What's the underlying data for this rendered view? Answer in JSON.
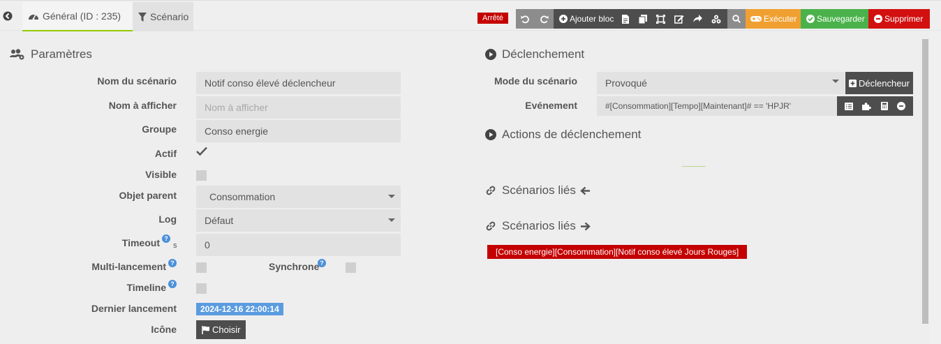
{
  "tabs": {
    "general": "Général (ID : 235)",
    "scenario": "Scénario"
  },
  "toolbar": {
    "status": "Arrêté",
    "add_block": "Ajouter bloc",
    "execute": "Exécuter",
    "save": "Sauvegarder",
    "delete": "Supprimer"
  },
  "params": {
    "title": "Paramètres",
    "name_label": "Nom du scénario",
    "name_value": "Notif conso élevé déclencheur",
    "display_label": "Nom à afficher",
    "display_placeholder": "Nom à afficher",
    "group_label": "Groupe",
    "group_value": "Conso energie",
    "active_label": "Actif",
    "visible_label": "Visible",
    "parent_label": "Objet parent",
    "parent_value": "Consommation",
    "log_label": "Log",
    "log_value": "Défaut",
    "timeout_label": "Timeout",
    "timeout_unit": "s",
    "timeout_value": "0",
    "multi_label": "Multi-lancement",
    "sync_label": "Synchrone",
    "timeline_label": "Timeline",
    "last_run_label": "Dernier lancement",
    "last_run_value": "2024-12-16 22:00:14",
    "icon_label": "Icône",
    "choose_label": "Choisir"
  },
  "trigger": {
    "title": "Déclenchement",
    "mode_label": "Mode du scénario",
    "mode_value": "Provoqué",
    "trigger_button": "Déclencheur",
    "event_label": "Evénement",
    "event_value": "#[Consommation][Tempo][Maintenant]# == 'HPJR'",
    "actions_title": "Actions de déclenchement",
    "linked_in_title": "Scénarios liés",
    "linked_out_title": "Scénarios liés",
    "linked_scenario": "[Conso energie][Consommation][Notif conso élevé Jours Rouges]"
  },
  "colors": {
    "status_red": "#c40000",
    "execute_orange": "#f0a030",
    "save_green": "#4bb24b",
    "delete_red": "#d21010",
    "date_blue": "#5b9ce0",
    "tab_active_underline": "#94ca02"
  },
  "icons": [
    "back-icon",
    "dashboard-icon",
    "filter-icon",
    "undo-icon",
    "redo-icon",
    "plus-circle-icon",
    "file-icon",
    "copy-icon",
    "expand-icon",
    "edit-icon",
    "share-icon",
    "cubes-icon",
    "search-icon",
    "gamepad-icon",
    "check-circle-icon",
    "minus-circle-icon",
    "users-cog-icon",
    "play-circle-icon",
    "link-icon",
    "arrow-left-icon",
    "arrow-right-icon",
    "help-icon",
    "flag-icon",
    "plus-square-icon",
    "list-icon",
    "puzzle-icon",
    "calculator-icon"
  ]
}
